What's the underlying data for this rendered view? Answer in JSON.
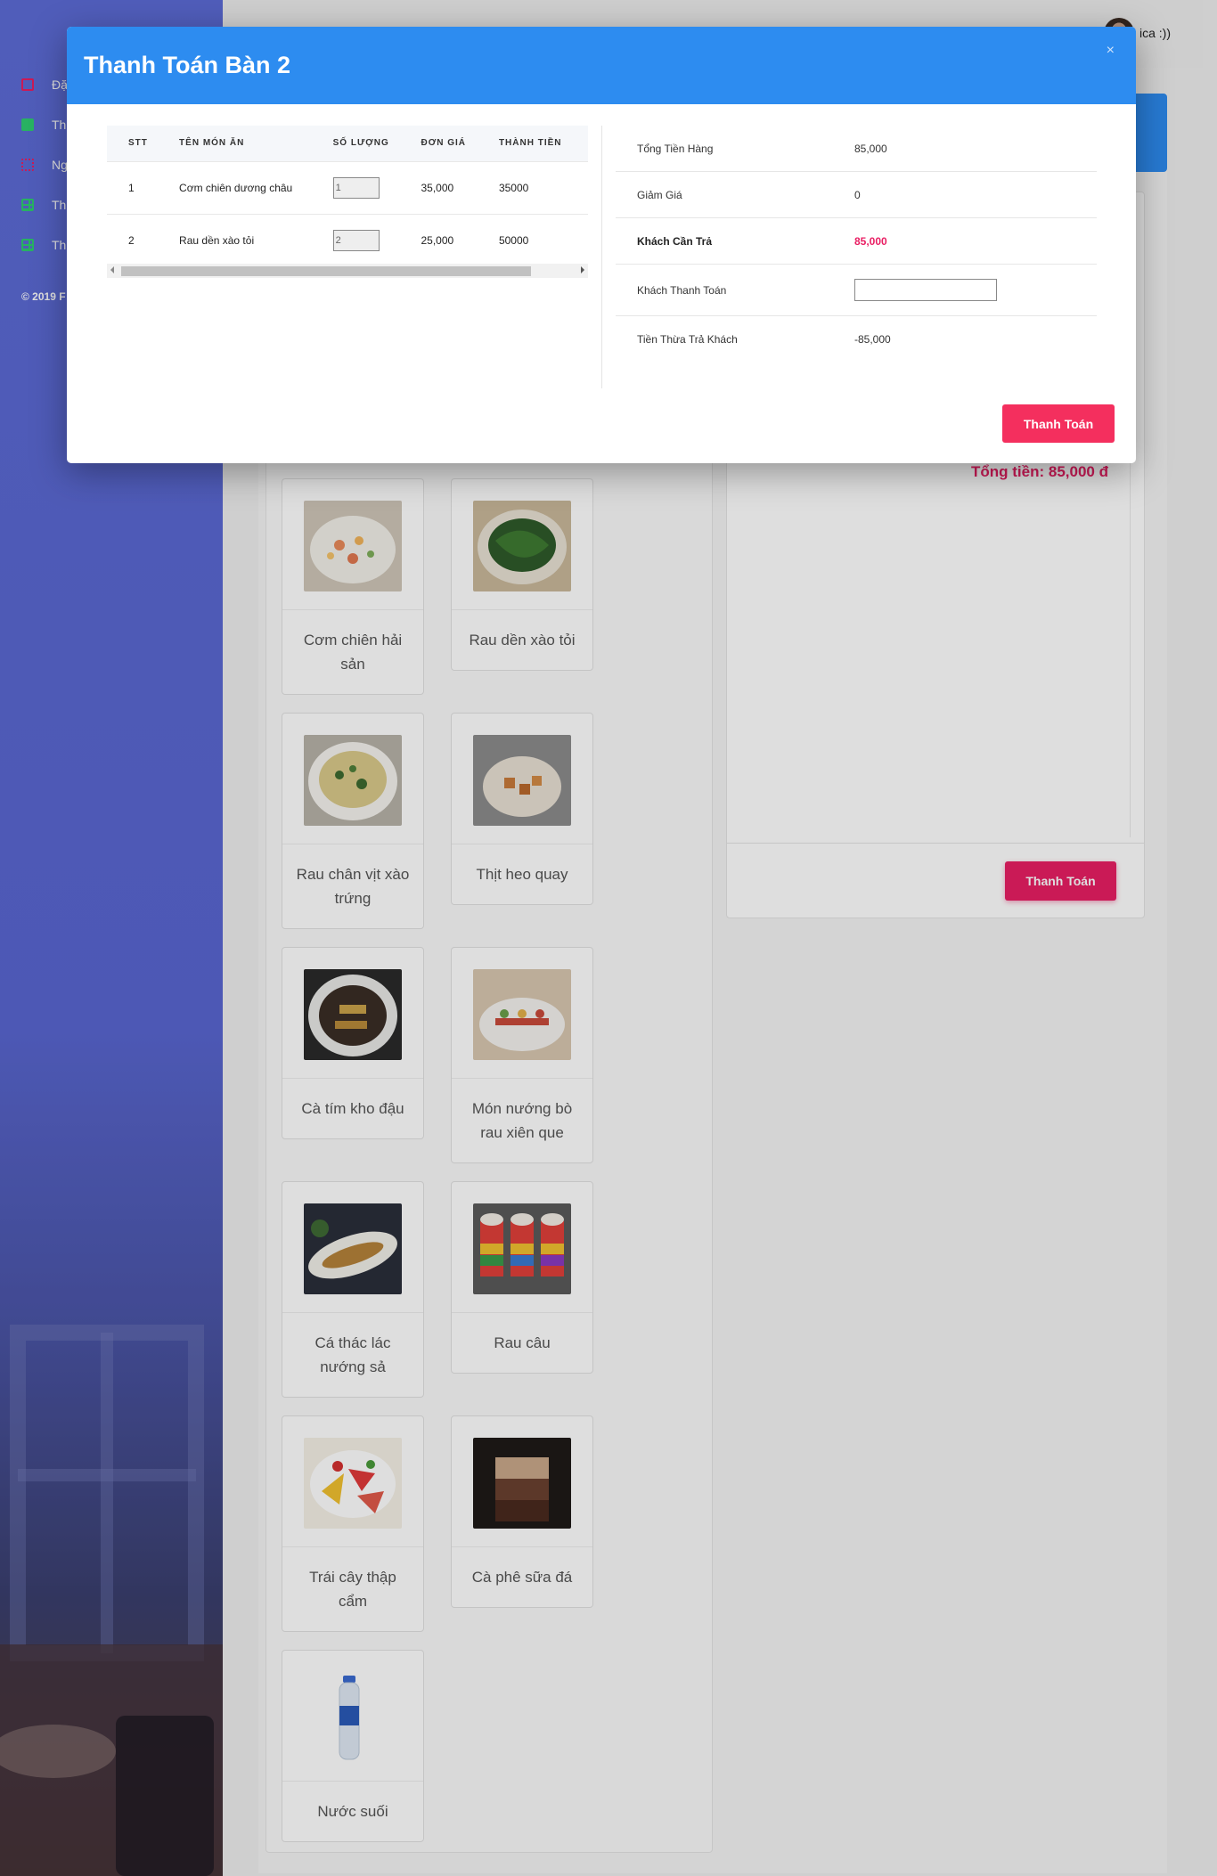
{
  "app": {
    "user_name": "ica :))",
    "copyright": "© 2019 F"
  },
  "sidebar": {
    "items": [
      {
        "label": "Đặ",
        "icon": "square-outline-icon",
        "color": "#e91e63"
      },
      {
        "label": "Th",
        "icon": "square-icon",
        "color": "#2ecc71"
      },
      {
        "label": "Ng",
        "icon": "grid-icon",
        "color": "#e91e63"
      },
      {
        "label": "Th",
        "icon": "table-icon",
        "color": "#2ecc71"
      },
      {
        "label": "Th",
        "icon": "table-icon",
        "color": "#2ecc71"
      }
    ]
  },
  "order": {
    "total_text": "Tổng tiền: 85,000 đ",
    "pay_button": "Thanh Toán"
  },
  "menu": {
    "items": [
      {
        "name": "Cơm chiên hải sản"
      },
      {
        "name": "Rau dền xào tỏi"
      },
      {
        "name": "Rau chân vịt xào trứng"
      },
      {
        "name": "Thịt heo quay"
      },
      {
        "name": "Cà tím kho đậu"
      },
      {
        "name": "Món nướng bò rau xiên que"
      },
      {
        "name": "Cá thác lác nướng sả"
      },
      {
        "name": "Rau câu"
      },
      {
        "name": "Trái cây thập cẩm"
      },
      {
        "name": "Cà phê sữa đá"
      },
      {
        "name": "Nước suối"
      }
    ]
  },
  "modal": {
    "title": "Thanh Toán Bàn 2",
    "close_label": "×",
    "table": {
      "headers": [
        "STT",
        "TÊN MÓN ĂN",
        "SỐ LƯỢNG",
        "ĐƠN GIÁ",
        "THÀNH TIỀN"
      ],
      "rows": [
        {
          "stt": "1",
          "name": "Cơm chiên dương châu",
          "qty": "1",
          "price": "35,000",
          "total": "35000"
        },
        {
          "stt": "2",
          "name": "Rau dền xào tỏi",
          "qty": "2",
          "price": "25,000",
          "total": "50000"
        }
      ]
    },
    "summary": {
      "subtotal_label": "Tổng Tiền Hàng",
      "subtotal_value": "85,000",
      "discount_label": "Giảm Giá",
      "discount_value": "0",
      "due_label": "Khách Cần Trả",
      "due_value": "85,000",
      "paid_label": "Khách Thanh Toán",
      "paid_value": "",
      "change_label": "Tiền Thừa Trả Khách",
      "change_value": "-85,000"
    },
    "pay_button": "Thanh Toán"
  },
  "colors": {
    "primary": "#2d8cf0",
    "accent": "#e91e63",
    "button": "#f42f5e"
  }
}
